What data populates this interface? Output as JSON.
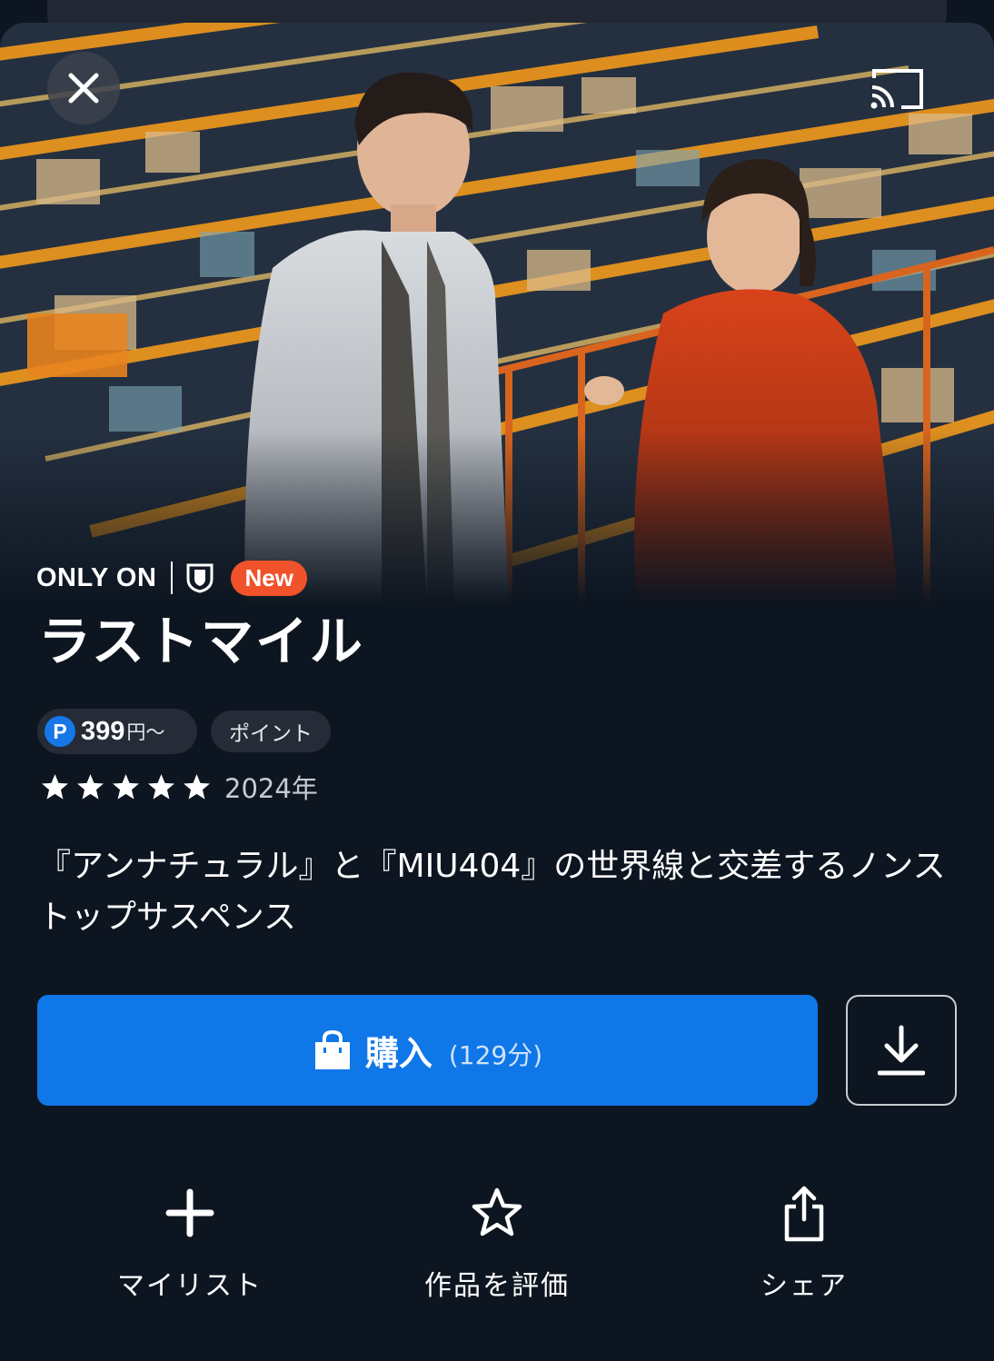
{
  "app": {
    "close_icon": "close-icon",
    "cast_icon": "cast-icon"
  },
  "badges": {
    "only_on": "ONLY ON",
    "service_icon": "shield-logo-icon",
    "new_label": "New",
    "new_color": "#f0522a"
  },
  "title": "ラストマイル",
  "price": {
    "icon_letter": "P",
    "amount": "399",
    "unit": "円〜",
    "points_label": "ポイント"
  },
  "rating": {
    "stars": 5,
    "year": "2024年"
  },
  "description": "『アンナチュラル』と『MIU404』の世界線と交差するノンストップサスペンス",
  "purchase": {
    "label": "購入",
    "duration": "(129分)",
    "color": "#0f77e8"
  },
  "actions": [
    {
      "label": "マイリスト",
      "icon": "plus-icon"
    },
    {
      "label": "作品を評価",
      "icon": "star-outline-icon"
    },
    {
      "label": "シェア",
      "icon": "share-icon"
    }
  ]
}
